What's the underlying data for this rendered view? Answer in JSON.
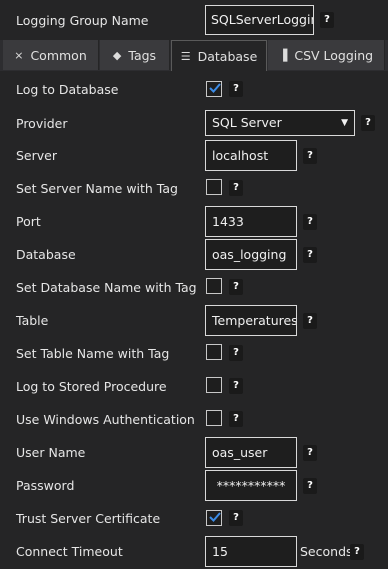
{
  "header": {
    "group_label": "Logging Group Name",
    "group_value": "SQLServerLogging",
    "help": "?"
  },
  "tabs": [
    {
      "label": "Common",
      "icon": "sort-icon",
      "glyph": "⨯"
    },
    {
      "label": "Tags",
      "icon": "tag-icon",
      "glyph": "◆"
    },
    {
      "label": "Database",
      "icon": "database-icon",
      "glyph": "☰"
    },
    {
      "label": "CSV Logging",
      "icon": "csv-icon",
      "glyph": "▐"
    }
  ],
  "form": {
    "log_to_db": {
      "label": "Log to Database",
      "checked": true
    },
    "provider": {
      "label": "Provider",
      "value": "SQL Server"
    },
    "server": {
      "label": "Server",
      "value": "localhost"
    },
    "server_tag": {
      "label": "Set Server Name with Tag",
      "checked": false
    },
    "port": {
      "label": "Port",
      "value": "1433"
    },
    "database": {
      "label": "Database",
      "value": "oas_logging"
    },
    "database_tag": {
      "label": "Set Database Name with Tag",
      "checked": false
    },
    "table": {
      "label": "Table",
      "value": "Temperatures"
    },
    "table_tag": {
      "label": "Set Table Name with Tag",
      "checked": false
    },
    "stored_proc": {
      "label": "Log to Stored Procedure",
      "checked": false
    },
    "windows_auth": {
      "label": "Use Windows Authentication",
      "checked": false
    },
    "user_name": {
      "label": "User Name",
      "value": "oas_user"
    },
    "password": {
      "label": "Password",
      "value": "***********"
    },
    "trust_cert": {
      "label": "Trust Server Certificate",
      "checked": true
    },
    "timeout": {
      "label": "Connect Timeout",
      "value": "15",
      "unit": "Seconds"
    }
  },
  "colors": {
    "check": "#3c8ce7",
    "background": "#252526"
  }
}
